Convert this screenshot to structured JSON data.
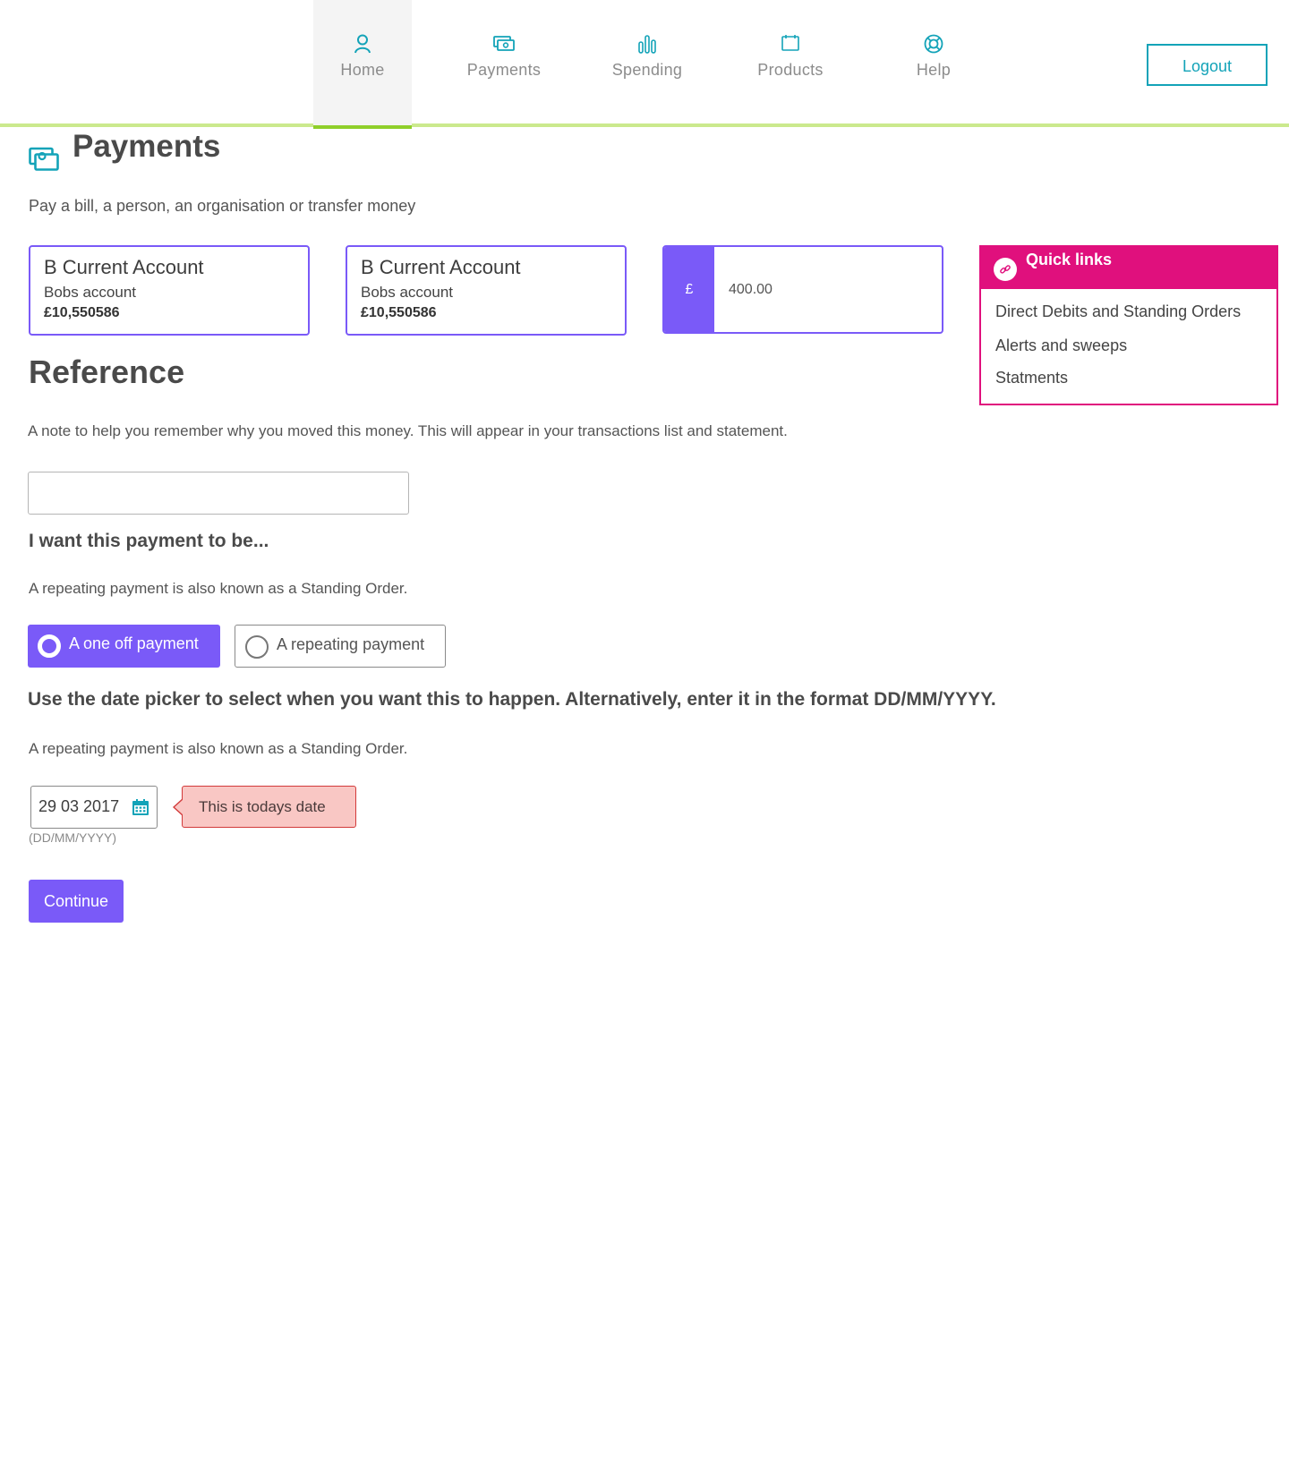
{
  "nav": {
    "items": [
      {
        "label": "Home",
        "icon": "user-icon",
        "active": true
      },
      {
        "label": "Payments",
        "icon": "money-icon"
      },
      {
        "label": "Spending",
        "icon": "bar-chart-icon"
      },
      {
        "label": "Products",
        "icon": "folder-icon"
      },
      {
        "label": "Help",
        "icon": "lifebuoy-icon"
      }
    ],
    "logout_label": "Logout"
  },
  "header": {
    "title": "Payments",
    "icon": "money-icon",
    "subtitle": "Pay a bill, a person, an organisation or transfer money"
  },
  "accounts": {
    "from": {
      "name": "B Current Account",
      "nickname": "Bobs account",
      "balance": "£10,550586"
    },
    "to": {
      "name": "B Current Account",
      "nickname": "Bobs account",
      "balance": "£10,550586"
    }
  },
  "amount": {
    "currency_symbol": "£",
    "value": "400.00"
  },
  "quick_links": {
    "title": "Quick links",
    "icon": "link-icon",
    "links": [
      "Direct Debits and Standing Orders",
      "Alerts and sweeps",
      "Statments"
    ]
  },
  "reference": {
    "heading": "Reference",
    "description": "A note to help you remember why you moved this money. This will appear in your transactions list and statement.",
    "value": ""
  },
  "payment_type": {
    "heading": "I want this payment to be...",
    "description": "A repeating payment is also known as a Standing Order.",
    "options": [
      "A one off payment",
      "A repeating payment"
    ],
    "selected": "A one off payment"
  },
  "date": {
    "heading": "Use the date picker to select when you want this to happen. Alternatively, enter it in the format DD/MM/YYYY.",
    "description": "A repeating payment is also known as a Standing Order.",
    "value": "29 03 2017",
    "format_hint": "(DD/MM/YYYY)",
    "tooltip": "This is todays date",
    "icon": "calendar-icon"
  },
  "continue_label": "Continue",
  "colors": {
    "primary": "#7a5af8",
    "accent_teal": "#13a3b8",
    "quick_links": "#e0107d",
    "nav_underline": "#cbe98d",
    "tooltip_bg": "#f9c7c4",
    "tooltip_border": "#d23a3a"
  }
}
